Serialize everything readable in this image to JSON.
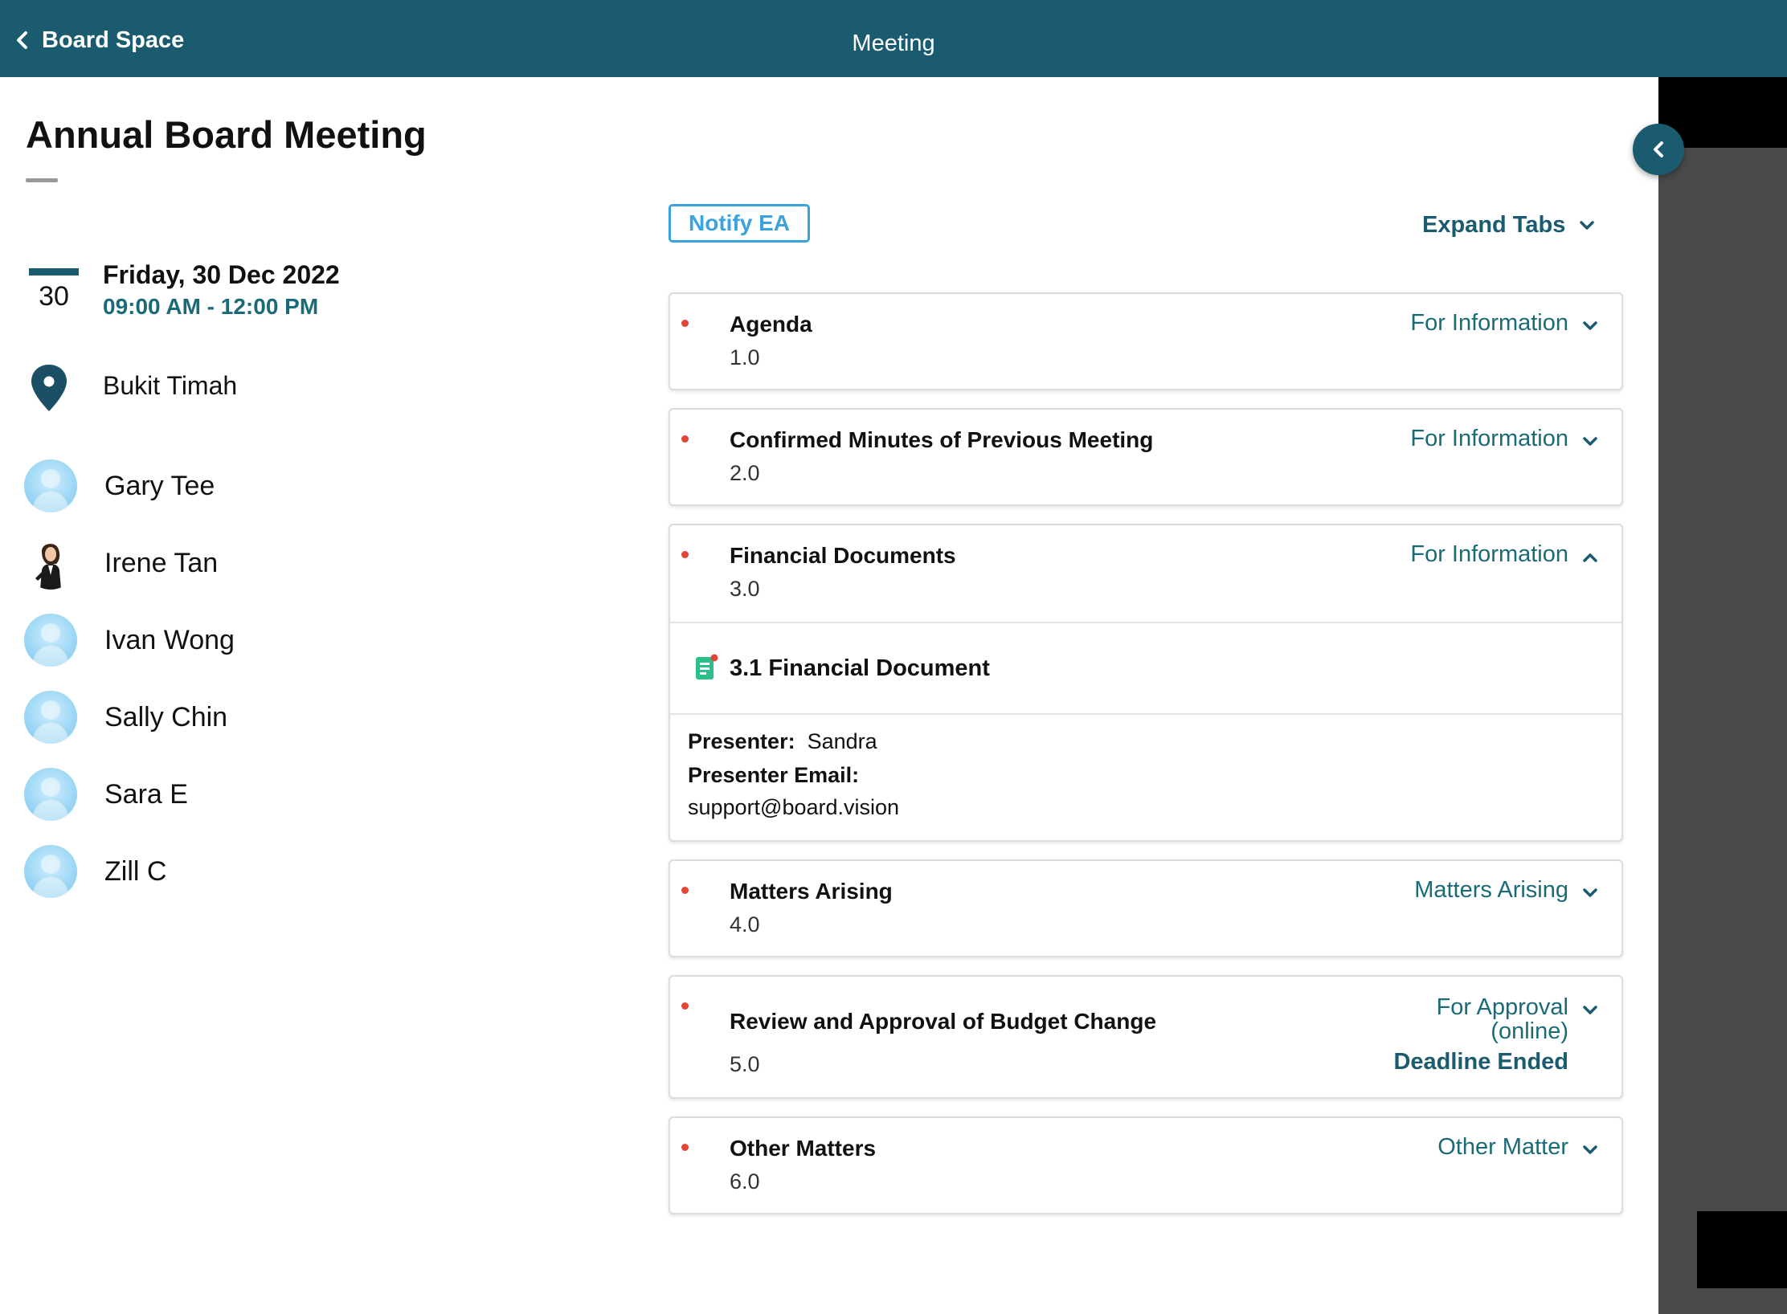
{
  "header": {
    "back_label": "Board Space",
    "title": "Meeting"
  },
  "meeting": {
    "title": "Annual Board Meeting",
    "calendar_day": "30",
    "date": "Friday, 30 Dec 2022",
    "time": "09:00 AM - 12:00 PM",
    "location": "Bukit Timah"
  },
  "attendees": [
    {
      "name": "Gary Tee",
      "avatar": "default-avatar"
    },
    {
      "name": "Irene Tan",
      "avatar": "photo-avatar"
    },
    {
      "name": "Ivan Wong",
      "avatar": "default-avatar"
    },
    {
      "name": "Sally Chin",
      "avatar": "default-avatar"
    },
    {
      "name": "Sara E",
      "avatar": "default-avatar"
    },
    {
      "name": "Zill C",
      "avatar": "default-avatar"
    }
  ],
  "actions": {
    "notify_label": "Notify EA",
    "expand_label": "Expand Tabs"
  },
  "agenda": [
    {
      "title": "Agenda",
      "number": "1.0",
      "tag": "For Information",
      "expanded": false
    },
    {
      "title": "Confirmed Minutes of Previous Meeting",
      "number": "2.0",
      "tag": "For Information",
      "expanded": false
    },
    {
      "title": "Financial Documents",
      "number": "3.0",
      "tag": "For Information",
      "expanded": true,
      "document": {
        "title": "3.1 Financial Document"
      },
      "presenter_label": "Presenter:",
      "presenter": "Sandra",
      "email_label": "Presenter Email:",
      "email": "support@board.vision"
    },
    {
      "title": "Matters Arising",
      "number": "4.0",
      "tag": "Matters Arising",
      "expanded": false
    },
    {
      "title": "Review and Approval of Budget Change",
      "number": "5.0",
      "tag_line1": "For Approval",
      "tag_line2": "(online)",
      "status": "Deadline Ended",
      "expanded": false
    },
    {
      "title": "Other Matters",
      "number": "6.0",
      "tag": "Other Matter",
      "expanded": false
    }
  ],
  "colors": {
    "header_bg": "#1a5b70",
    "accent_teal": "#1a6b78",
    "notify_blue": "#3aa2dc",
    "unread_dot": "#e04535"
  },
  "icons": {
    "back": "chevron-left-icon",
    "collapse": "chevron-left-icon",
    "calendar": "calendar-icon",
    "location": "map-pin-icon",
    "document": "document-icon"
  }
}
